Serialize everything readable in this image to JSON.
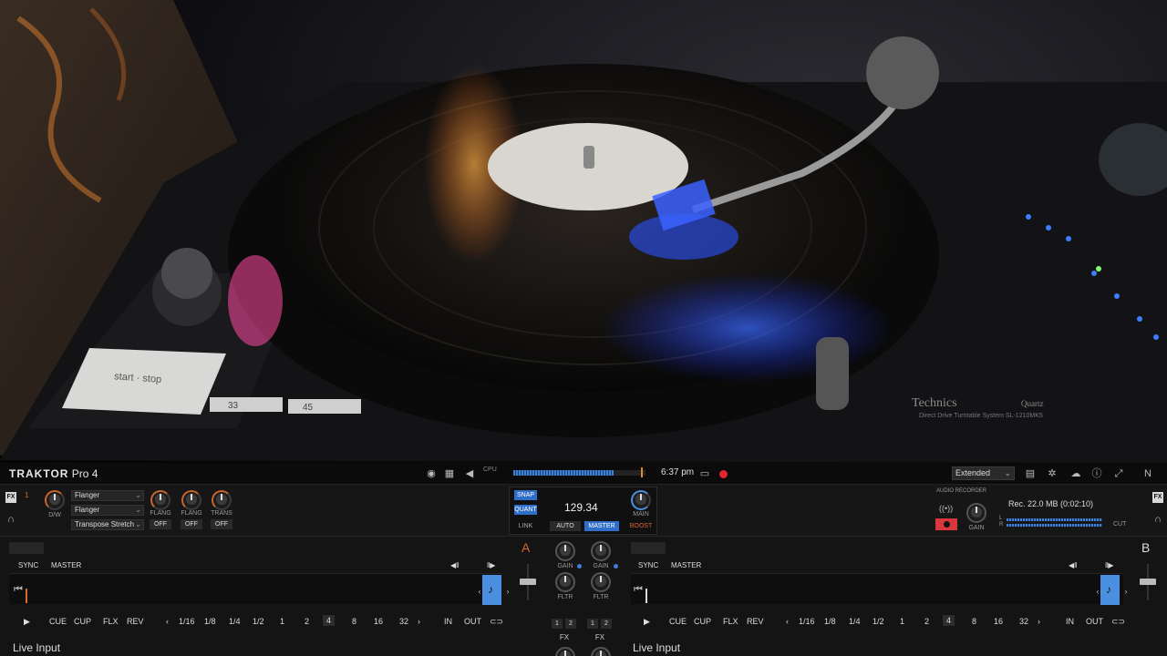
{
  "topbar": {
    "logo_main": "TRAKTOR",
    "logo_pro": " Pro 4",
    "cpu_label": "CPU",
    "clock": "6:37 pm",
    "layout_value": "Extended"
  },
  "fx": {
    "unit_label": "FX",
    "unit_number": "1",
    "dw_label": "D/W",
    "slots": [
      "Flanger",
      "Flanger",
      "Transpose Stretch"
    ],
    "knob_labels": [
      "FLANG",
      "FLANG",
      "TRANS"
    ],
    "button_labels": [
      "OFF",
      "OFF",
      "OFF"
    ]
  },
  "master": {
    "snap": "SNAP",
    "quant": "QUANT",
    "link": "LINK",
    "tempo": "129.34",
    "auto": "AUTO",
    "master": "MASTER",
    "main": "MAIN",
    "boost": "BOOST"
  },
  "recorder": {
    "title": "AUDIO RECORDER",
    "gain": "GAIN",
    "info": "Rec. 22.0 MB (0:02:10)",
    "cut": "CUT",
    "l": "L",
    "r": "R"
  },
  "deck_a": {
    "letter": "A",
    "sync": "SYNC",
    "master": "MASTER",
    "play_icon": "▶",
    "cue": "CUE",
    "cup": "CUP",
    "flx": "FLX",
    "rev": "REV",
    "loops": [
      "1/16",
      "1/8",
      "1/4",
      "1/2",
      "1",
      "2",
      "4",
      "8",
      "16",
      "32"
    ],
    "in": "IN",
    "out": "OUT",
    "source": "Live Input"
  },
  "deck_b": {
    "letter": "B",
    "sync": "SYNC",
    "master": "MASTER",
    "play_icon": "▶",
    "cue": "CUE",
    "cup": "CUP",
    "flx": "FLX",
    "rev": "REV",
    "loops": [
      "1/16",
      "1/8",
      "1/4",
      "1/2",
      "1",
      "2",
      "4",
      "8",
      "16",
      "32"
    ],
    "in": "IN",
    "out": "OUT",
    "source": "Live Input"
  },
  "mixer": {
    "gain": "GAIN",
    "fltr": "FLTR",
    "fx": "FX",
    "fx_btns": [
      "1",
      "2"
    ]
  },
  "photo": {
    "start_stop": "start · stop",
    "speed_33": "33",
    "speed_45": "45",
    "brand": "Technics",
    "brand_model": "Quartz",
    "brand_sub": "Direct Drive Turntable System SL-1210MK5"
  },
  "colors": {
    "accent_blue": "#2f6fc9",
    "deck_orange": "#d9662c",
    "record_red": "#e0262c"
  }
}
